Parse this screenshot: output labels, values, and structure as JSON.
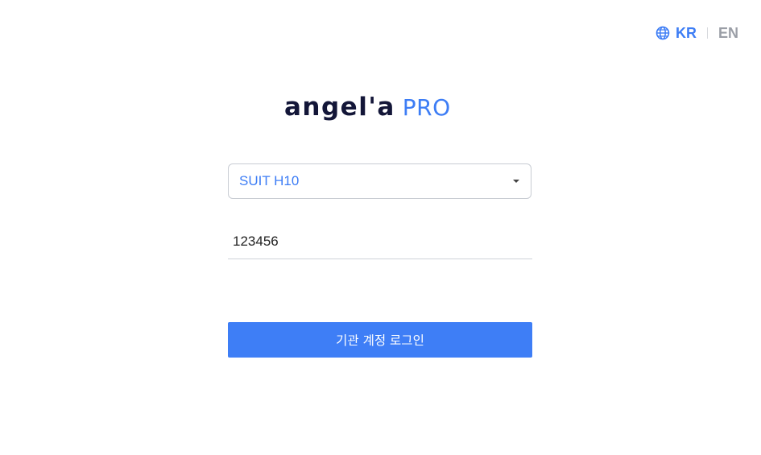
{
  "language": {
    "active": "KR",
    "alternate": "EN"
  },
  "logo": {
    "main": "angel'a",
    "suffix": "PRO"
  },
  "device_select": {
    "selected": "SUIT H10"
  },
  "code_field": {
    "value": "123456"
  },
  "login_button": {
    "label": "기관 계정 로그인"
  },
  "colors": {
    "accent": "#3e7ef6",
    "logo_dark": "#131638",
    "muted": "#9a9ea6"
  }
}
